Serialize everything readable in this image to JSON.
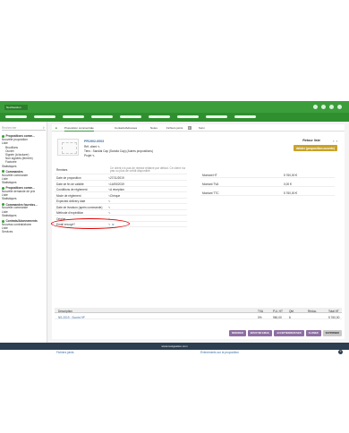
{
  "app": {
    "logo": "NextGestion"
  },
  "sidebar": {
    "search_placeholder": "Rechercher",
    "items": [
      {
        "label": "Propositions comm...",
        "type": "h"
      },
      {
        "label": "Nouvelle proposition",
        "type": "n"
      },
      {
        "label": "Liste",
        "type": "n"
      },
      {
        "label": "Brouillons",
        "type": "i"
      },
      {
        "label": "Ouvert",
        "type": "i"
      },
      {
        "label": "Signée (à facturer)",
        "type": "i"
      },
      {
        "label": "Non signées (fermée)",
        "type": "i"
      },
      {
        "label": "Facturée",
        "type": "i"
      },
      {
        "label": "Statistiques",
        "type": "n"
      },
      {
        "label": "Commandes",
        "type": "h"
      },
      {
        "label": "Nouvelle commande",
        "type": "n"
      },
      {
        "label": "Liste",
        "type": "n"
      },
      {
        "label": "Statistiques",
        "type": "n"
      },
      {
        "label": "Propositions comm...",
        "type": "h"
      },
      {
        "label": "Nouvelle demande de prix",
        "type": "n"
      },
      {
        "label": "Liste",
        "type": "n"
      },
      {
        "label": "Statistiques",
        "type": "n"
      },
      {
        "label": "Commandes fourniss...",
        "type": "h"
      },
      {
        "label": "Nouvelle commande",
        "type": "n"
      },
      {
        "label": "Liste",
        "type": "n"
      },
      {
        "label": "Statistiques",
        "type": "n"
      },
      {
        "label": "Contrats/Abonnements",
        "type": "h"
      },
      {
        "label": "Nouveau contrat/abonn",
        "type": "n"
      },
      {
        "label": "Liste",
        "type": "n"
      },
      {
        "label": "Services",
        "type": "n"
      }
    ]
  },
  "tabs": [
    "Proposition commerciale",
    "Contacts/Adresses",
    "Notes",
    "Fichiers joints",
    "Suivi"
  ],
  "tab_badge": "1",
  "proposal": {
    "id": "PR1902-0003",
    "ref_client": "Réf. client",
    "tiers": "Tiers : Sandial Cap (Sandia Cap) (Autres propositions)",
    "projet": "Projet",
    "back": "Retour liste",
    "validate": "Valider (proposition ouverte)"
  },
  "fields": [
    {
      "label": "Remises",
      "value": "Ce client n'a pas de remise relative par défaut. Ce client n'a pas ou plus de crédit disponible"
    },
    {
      "label": "Date de proposition",
      "value": "27/11/2019"
    },
    {
      "label": "Date de fin de validité",
      "value": "14/05/2019"
    },
    {
      "label": "Conditions de règlement",
      "value": "A réception"
    },
    {
      "label": "Mode de règlement",
      "value": "Chèque"
    },
    {
      "label": "Expected delivery date",
      "value": ""
    },
    {
      "label": "Date de livraison (après commande)",
      "value": ""
    },
    {
      "label": "Méthode d'expédition",
      "value": ""
    },
    {
      "label": "Origine",
      "value": ""
    },
    {
      "label": "Email envoyé?",
      "value": ""
    }
  ],
  "totals": [
    {
      "label": "Montant HT",
      "value": "5 760,00 €"
    },
    {
      "label": "Montant TVA",
      "value": "0,00 €"
    },
    {
      "label": "Montant TTC",
      "value": "5 760,00 €"
    }
  ],
  "lines": {
    "headers": [
      "Description",
      "TVA",
      "P.U. HT",
      "Qté",
      "Réduc.",
      "Total HT"
    ],
    "rows": [
      [
        "NS-2019 - Souris HP",
        "0%",
        "960,00",
        "6",
        "",
        "5 760,00"
      ]
    ]
  },
  "buttons": [
    "MODIFIER",
    "ENVOYER EMAIL",
    "ACCEPTER/REFUSER",
    "CLONER",
    "SUPPRIMER"
  ],
  "bottom": {
    "files": "Fichiers joints",
    "events": "Événements sur la proposition"
  },
  "footer": "www.nextgestion.com",
  "colors": {
    "brand": "#3b9e3b",
    "accent": "#8e6fa3",
    "validate": "#c9a227",
    "annotation": "#dd0000"
  }
}
